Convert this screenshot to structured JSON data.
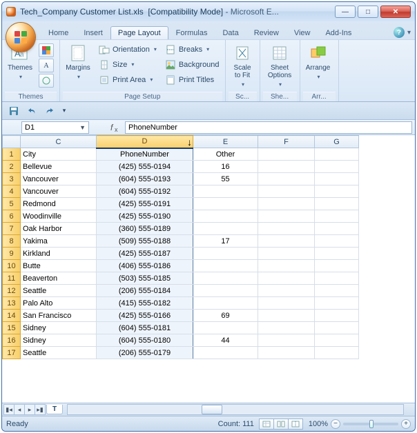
{
  "title": {
    "doc": "Tech_Company Customer List.xls",
    "mode": "[Compatibility Mode]",
    "app": "Microsoft E..."
  },
  "tabs": [
    "Home",
    "Insert",
    "Page Layout",
    "Formulas",
    "Data",
    "Review",
    "View",
    "Add-Ins"
  ],
  "active_tab": 2,
  "ribbon": {
    "themes": {
      "title": "Themes",
      "themes": "Themes",
      "colors": "",
      "fonts": "",
      "effects": ""
    },
    "page_setup": {
      "title": "Page Setup",
      "margins": "Margins",
      "orientation": "Orientation",
      "breaks": "Breaks",
      "size": "Size",
      "background": "Background",
      "print_area": "Print Area",
      "print_titles": "Print Titles"
    },
    "scale": {
      "title": "Sc...",
      "label": "Scale\nto Fit"
    },
    "sheet": {
      "title": "She...",
      "label": "Sheet\nOptions"
    },
    "arrange": {
      "title": "Arr...",
      "label": "Arrange"
    }
  },
  "namebox": "D1",
  "formula": "PhoneNumber",
  "columns": [
    "C",
    "D",
    "E",
    "F",
    "G"
  ],
  "selected_col": "D",
  "headers": {
    "C": "City",
    "D": "PhoneNumber",
    "E": "Other"
  },
  "rows": [
    {
      "n": 1,
      "C": "City",
      "D": "PhoneNumber",
      "E": "Other"
    },
    {
      "n": 2,
      "C": "Bellevue",
      "D": "(425) 555-0194",
      "E": "16"
    },
    {
      "n": 3,
      "C": "Vancouver",
      "D": "(604) 555-0193",
      "E": "55"
    },
    {
      "n": 4,
      "C": "Vancouver",
      "D": "(604) 555-0192",
      "E": ""
    },
    {
      "n": 5,
      "C": "Redmond",
      "D": "(425) 555-0191",
      "E": ""
    },
    {
      "n": 6,
      "C": "Woodinville",
      "D": "(425) 555-0190",
      "E": ""
    },
    {
      "n": 7,
      "C": "Oak Harbor",
      "D": "(360) 555-0189",
      "E": ""
    },
    {
      "n": 8,
      "C": "Yakima",
      "D": "(509) 555-0188",
      "E": "17"
    },
    {
      "n": 9,
      "C": "Kirkland",
      "D": "(425) 555-0187",
      "E": ""
    },
    {
      "n": 10,
      "C": "Butte",
      "D": "(406) 555-0186",
      "E": ""
    },
    {
      "n": 11,
      "C": "Beaverton",
      "D": "(503) 555-0185",
      "E": ""
    },
    {
      "n": 12,
      "C": "Seattle",
      "D": "(206) 555-0184",
      "E": ""
    },
    {
      "n": 13,
      "C": "Palo Alto",
      "D": "(415) 555-0182",
      "E": ""
    },
    {
      "n": 14,
      "C": "San Francisco",
      "D": "(425) 555-0166",
      "E": "69"
    },
    {
      "n": 15,
      "C": "Sidney",
      "D": "(604) 555-0181",
      "E": ""
    },
    {
      "n": 16,
      "C": "Sidney",
      "D": "(604) 555-0180",
      "E": "44"
    },
    {
      "n": 17,
      "C": "Seattle",
      "D": "(206) 555-0179",
      "E": ""
    }
  ],
  "sheet_tab": "T",
  "status": {
    "ready": "Ready",
    "count_label": "Count:",
    "count": "111",
    "zoom": "100%"
  }
}
